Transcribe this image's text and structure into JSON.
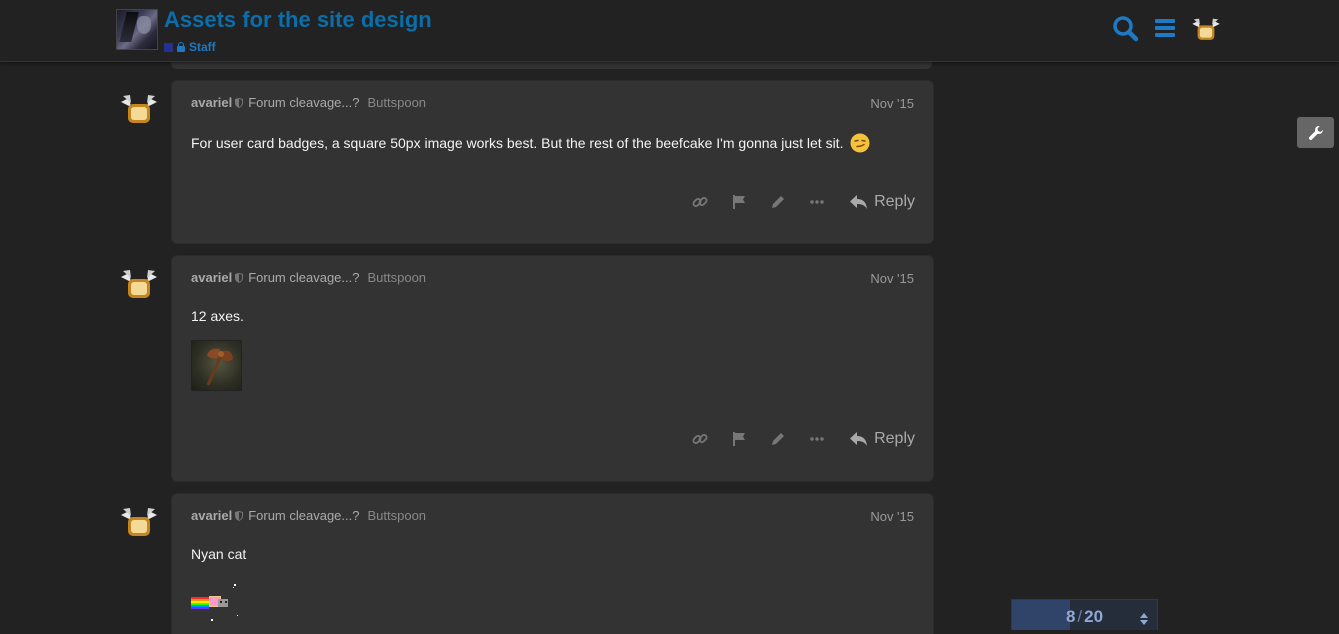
{
  "header": {
    "title": "Assets for the site design",
    "category": "Staff",
    "category_color": "#25318e",
    "title_color": "#0a6eab",
    "icons": [
      "search-icon",
      "hamburger-menu-icon",
      "user-avatar"
    ]
  },
  "admin": {
    "icon": "wrench-icon"
  },
  "posts": [
    {
      "username": "avariel",
      "user_title": "Forum cleavage...?",
      "flair": "Buttspoon",
      "date": "Nov '15",
      "text": "For user card badges, a square 50px image works best. But the rest of the beefcake I'm gonna just let sit.",
      "emoji": "smirk-emoji",
      "reply_label": "Reply"
    },
    {
      "username": "avariel",
      "user_title": "Forum cleavage...?",
      "flair": "Buttspoon",
      "date": "Nov '15",
      "text": "12 axes.",
      "image": "axe-thumbnail",
      "reply_label": "Reply"
    },
    {
      "username": "avariel",
      "user_title": "Forum cleavage...?",
      "flair": "Buttspoon",
      "date": "Nov '15",
      "text": "Nyan cat",
      "image": "nyan-cat-gif"
    }
  ],
  "post_actions": [
    "link-icon",
    "flag-icon",
    "edit-pencil-icon",
    "more-ellipsis-icon"
  ],
  "timeline": {
    "current": "8",
    "separator": "/",
    "total": "20",
    "progress": 0.4
  }
}
